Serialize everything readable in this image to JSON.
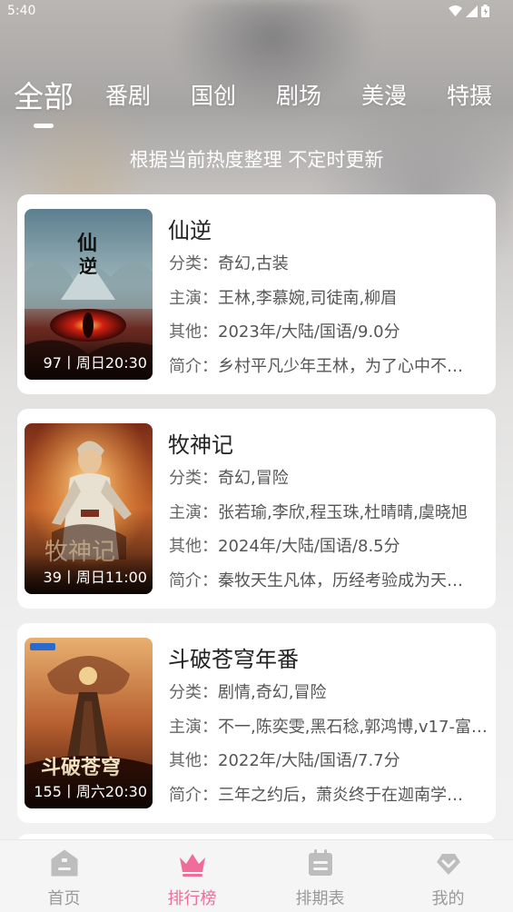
{
  "status_bar": {
    "time": "5:40"
  },
  "tabs": [
    {
      "label": "全部",
      "active": true
    },
    {
      "label": "番剧",
      "active": false
    },
    {
      "label": "国创",
      "active": false
    },
    {
      "label": "剧场",
      "active": false
    },
    {
      "label": "美漫",
      "active": false
    },
    {
      "label": "特摄",
      "active": false
    }
  ],
  "subtitle": "根据当前热度整理 不定时更新",
  "labels": {
    "category": "分类：",
    "cast": "主演：",
    "other": "其他：",
    "synopsis": "简介："
  },
  "cards": [
    {
      "title": "仙逆",
      "category": "奇幻,古装",
      "cast": "王林,李慕婉,司徒南,柳眉",
      "other": "2023年/大陆/国语/9.0分",
      "synopsis": "乡村平凡少年王林，为了心中不…",
      "poster_meta": "97丨周日20:30",
      "poster_text": "仙逆"
    },
    {
      "title": "牧神记",
      "category": "奇幻,冒险",
      "cast": "张若瑜,李欣,程玉珠,杜晴晴,虞晓旭",
      "other": "2024年/大陆/国语/8.5分",
      "synopsis": "秦牧天生凡体，历经考验成为天…",
      "poster_meta": "39丨周日11:00",
      "poster_text": "牧神记"
    },
    {
      "title": "斗破苍穹年番",
      "category": "剧情,奇幻,冒险",
      "cast": "不一,陈奕雯,黑石稔,郭鸿博,v17-富…",
      "other": "2022年/大陆/国语/7.7分",
      "synopsis": "三年之约后，萧炎终于在迦南学…",
      "poster_meta": "155丨周六20:30",
      "poster_text": "斗破苍穹"
    }
  ],
  "bottom_nav": [
    {
      "label": "首页",
      "icon": "home-icon",
      "active": false
    },
    {
      "label": "排行榜",
      "icon": "crown-icon",
      "active": true
    },
    {
      "label": "排期表",
      "icon": "calendar-icon",
      "active": false
    },
    {
      "label": "我的",
      "icon": "heart-icon",
      "active": false
    }
  ],
  "colors": {
    "accent": "#f06c9b",
    "inactive": "#9a9a9a",
    "card_bg": "#ffffff"
  }
}
